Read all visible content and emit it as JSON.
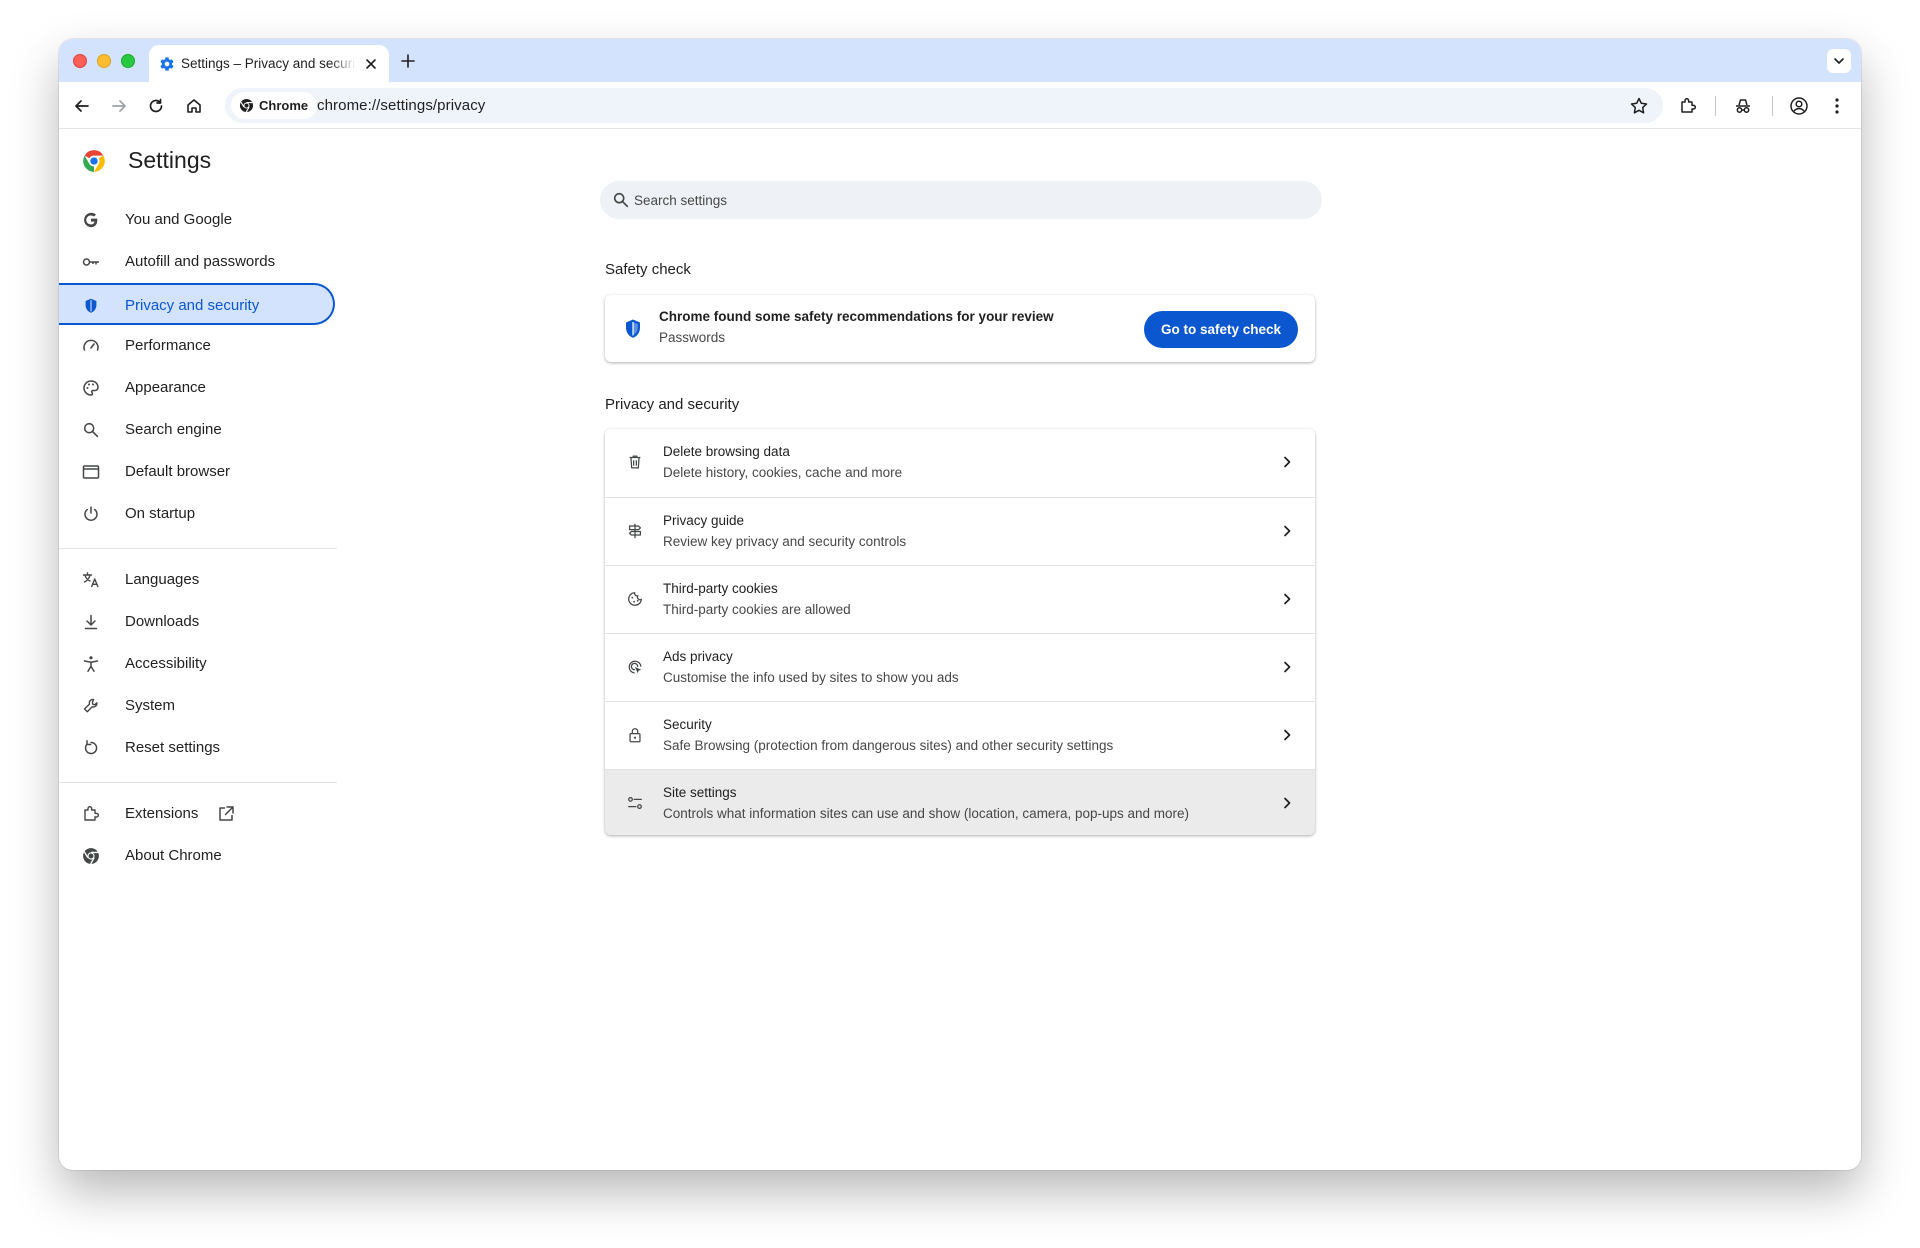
{
  "browser": {
    "tab_title": "Settings – Privacy and security",
    "omnibox_chip": "Chrome",
    "url": "chrome://settings/privacy"
  },
  "sidebar": {
    "title": "Settings",
    "groups": [
      {
        "items": [
          {
            "id": "you-and-google",
            "label": "You and Google",
            "icon": "google-g-icon"
          },
          {
            "id": "autofill",
            "label": "Autofill and passwords",
            "icon": "key-icon"
          },
          {
            "id": "privacy",
            "label": "Privacy and security",
            "icon": "shield-icon",
            "active": true
          },
          {
            "id": "performance",
            "label": "Performance",
            "icon": "speedometer-icon"
          },
          {
            "id": "appearance",
            "label": "Appearance",
            "icon": "palette-icon"
          },
          {
            "id": "search-engine",
            "label": "Search engine",
            "icon": "search-icon"
          },
          {
            "id": "default-browser",
            "label": "Default browser",
            "icon": "browser-window-icon"
          },
          {
            "id": "on-startup",
            "label": "On startup",
            "icon": "power-icon"
          }
        ]
      },
      {
        "items": [
          {
            "id": "languages",
            "label": "Languages",
            "icon": "translate-icon"
          },
          {
            "id": "downloads",
            "label": "Downloads",
            "icon": "download-icon"
          },
          {
            "id": "accessibility",
            "label": "Accessibility",
            "icon": "accessibility-icon"
          },
          {
            "id": "system",
            "label": "System",
            "icon": "wrench-icon"
          },
          {
            "id": "reset",
            "label": "Reset settings",
            "icon": "reset-icon"
          }
        ]
      },
      {
        "items": [
          {
            "id": "extensions",
            "label": "Extensions",
            "icon": "puzzle-icon"
          },
          {
            "id": "about",
            "label": "About Chrome",
            "icon": "chrome-icon"
          }
        ]
      }
    ]
  },
  "search": {
    "placeholder": "Search settings"
  },
  "safety_check": {
    "section_title": "Safety check",
    "title": "Chrome found some safety recommendations for your review",
    "subtitle": "Passwords",
    "button_label": "Go to safety check"
  },
  "privacy": {
    "section_title": "Privacy and security",
    "rows": [
      {
        "title": "Delete browsing data",
        "subtitle": "Delete history, cookies, cache and more",
        "icon": "trash-icon"
      },
      {
        "title": "Privacy guide",
        "subtitle": "Review key privacy and security controls",
        "icon": "signpost-icon"
      },
      {
        "title": "Third-party cookies",
        "subtitle": "Third-party cookies are allowed",
        "icon": "cookie-icon"
      },
      {
        "title": "Ads privacy",
        "subtitle": "Customise the info used by sites to show you ads",
        "icon": "ads-privacy-icon"
      },
      {
        "title": "Security",
        "subtitle": "Safe Browsing (protection from dangerous sites) and other security settings",
        "icon": "lock-icon"
      },
      {
        "title": "Site settings",
        "subtitle": "Controls what information sites can use and show (location, camera, pop-ups and more)",
        "icon": "sliders-icon",
        "hovered": true
      }
    ]
  },
  "colors": {
    "accent": "#0b57d0",
    "active_nav_bg": "#d3e3fd",
    "tabstrip_bg": "#d3e3fd"
  }
}
